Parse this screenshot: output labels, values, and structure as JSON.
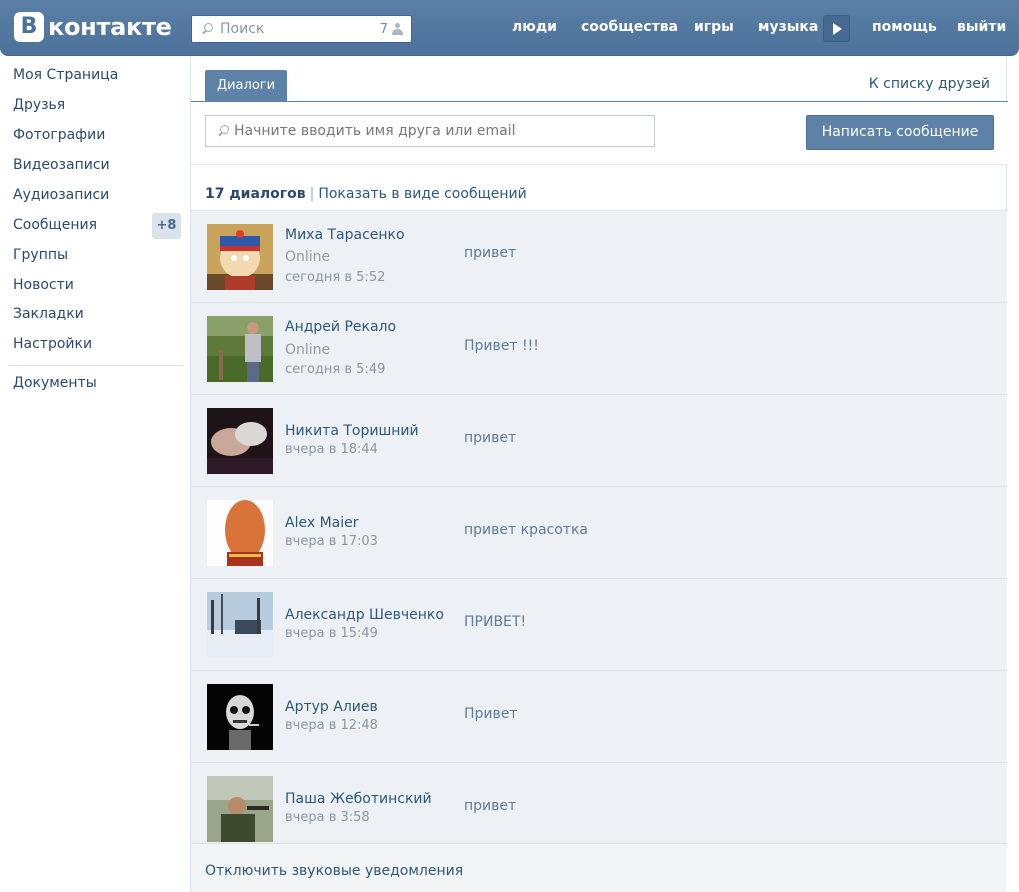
{
  "header": {
    "logo_letter": "В",
    "logo_text": "контакте",
    "search_placeholder": "Поиск",
    "search_count": "7",
    "nav": {
      "people": "люди",
      "communities": "сообщества",
      "games": "игры",
      "music": "музыка",
      "help": "помощь",
      "logout": "выйти"
    },
    "accent_color": "#4c729b"
  },
  "sidebar": {
    "items": [
      {
        "label": "Моя Страница"
      },
      {
        "label": "Друзья"
      },
      {
        "label": "Фотографии"
      },
      {
        "label": "Видеозаписи"
      },
      {
        "label": "Аудиозаписи"
      },
      {
        "label": "Сообщения",
        "badge": "+8"
      },
      {
        "label": "Группы"
      },
      {
        "label": "Новости"
      },
      {
        "label": "Закладки"
      },
      {
        "label": "Настройки"
      },
      {
        "label": "Документы"
      }
    ]
  },
  "main": {
    "tab_label": "Диалоги",
    "friends_link": "К списку друзей",
    "friend_input_placeholder": "Начните вводить имя друга или email",
    "write_button": "Написать сообщение",
    "dialog_count": "17 диалогов",
    "separator": "|",
    "show_as_messages": "Показать в виде сообщений",
    "dialogs": [
      {
        "name": "Миха Тарасенко",
        "status": "Online",
        "time": "сегодня в 5:52",
        "message": "привет"
      },
      {
        "name": "Андрей Рекало",
        "status": "Online",
        "time": "сегодня в 5:49",
        "message": "Привет !!!"
      },
      {
        "name": "Никита Торишний",
        "time": "вчера в 18:44",
        "message": "привет"
      },
      {
        "name": "Alex Maier",
        "time": "вчера в 17:03",
        "message": "привет красотка"
      },
      {
        "name": "Александр Шевченко",
        "time": "вчера в 15:49",
        "message": "ПРИВЕТ!"
      },
      {
        "name": "Артур Алиев",
        "time": "вчера в 12:48",
        "message": "Привет"
      },
      {
        "name": "Паша Жеботинский",
        "time": "вчера в 3:58",
        "message": "привет"
      }
    ],
    "footer_link": "Отключить звуковые уведомления"
  }
}
